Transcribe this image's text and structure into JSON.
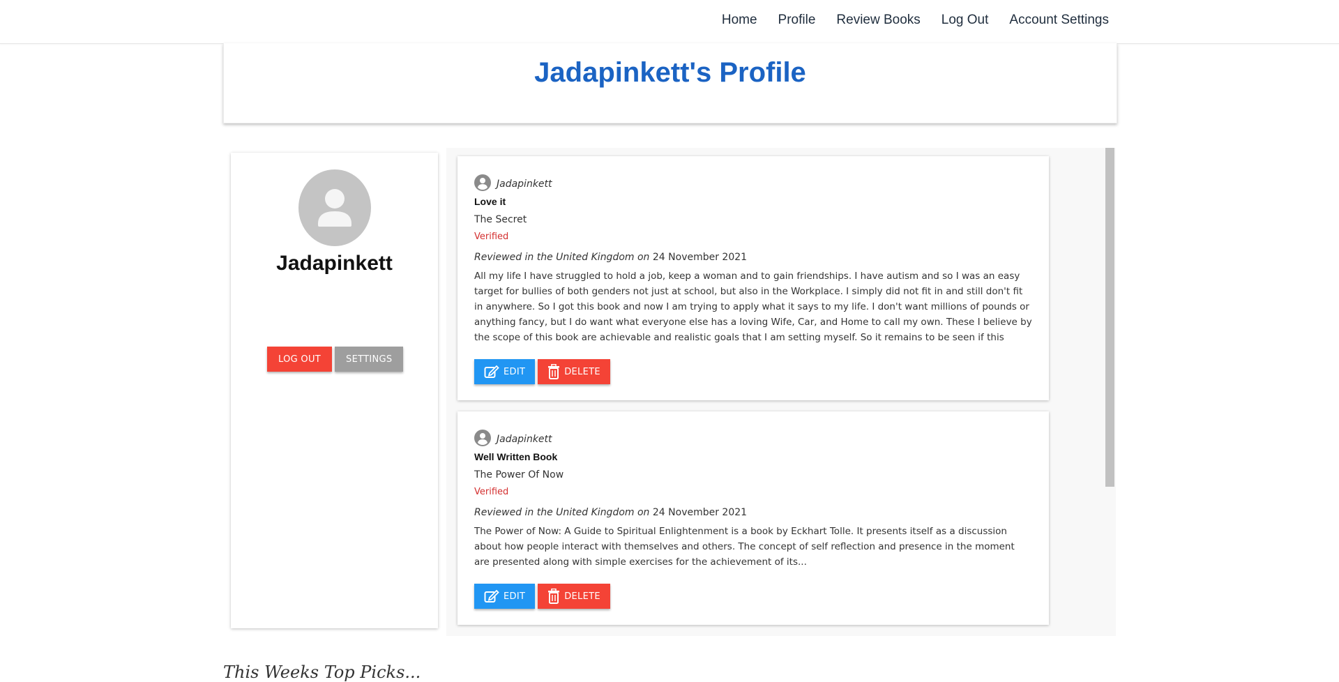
{
  "nav": {
    "items": [
      "Home",
      "Profile",
      "Review Books",
      "Log Out",
      "Account Settings"
    ]
  },
  "header": {
    "title": "Jadapinkett's Profile"
  },
  "profile": {
    "name": "Jadapinkett",
    "logout_label": "LOG OUT",
    "settings_label": "SETTINGS"
  },
  "reviews": [
    {
      "user": "Jadapinkett",
      "title": "Love it",
      "book": "The Secret",
      "verified": "Verified",
      "meta_prefix": "Reviewed in the United Kingdom on",
      "date": "24 November 2021",
      "body": "All my life I have struggled to hold a job, keep a woman and to gain friendships. I have autism and so I was an easy target for bullies of both genders not just at school, but also in the Workplace. I simply did not fit in and still don't fit in anywhere. So I got this book and now I am trying to apply what it says to my life. I don't want millions of pounds or anything fancy, but I do want what everyone else has a loving Wife, Car, and Home to call my own. These I believe by the scope of this book are achievable and realistic goals that I am setting myself. So it remains to be seen if this",
      "edit_label": "EDIT",
      "delete_label": "DELETE"
    },
    {
      "user": "Jadapinkett",
      "title": "Well Written Book",
      "book": "The Power Of Now",
      "verified": "Verified",
      "meta_prefix": "Reviewed in the United Kingdom on",
      "date": "24 November 2021",
      "body": "The Power of Now: A Guide to Spiritual Enlightenment is a book by Eckhart Tolle. It presents itself as a discussion about how people interact with themselves and others. The concept of self reflection and presence in the moment are presented along with simple exercises for the achievement of its...",
      "edit_label": "EDIT",
      "delete_label": "DELETE"
    }
  ],
  "section": {
    "top_picks": "This Weeks Top Picks..."
  },
  "colors": {
    "title_blue": "#1b63c3",
    "danger": "#f44336",
    "primary": "#2196f3",
    "neutral": "#9e9e9e",
    "verified_red": "#d32f2f"
  }
}
